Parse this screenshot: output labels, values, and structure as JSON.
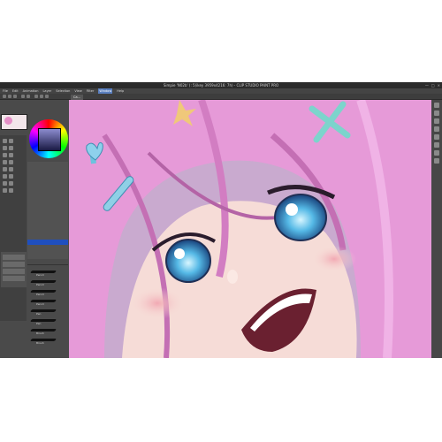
{
  "window": {
    "title": "Simpie 'N02b' (: 5(ikey 3959x4216: 7h) - CLIP STUDIO PAINT PRO",
    "controls": [
      "—",
      "□",
      "×"
    ]
  },
  "menubar": {
    "items": [
      "File",
      "Edit",
      "Animation",
      "Layer",
      "Selection",
      "View",
      "Filter",
      "Window",
      "Help"
    ],
    "active_index": 7
  },
  "canvas_tab": {
    "label": "Ca..."
  },
  "colors": {
    "accent": "#5a7fbf",
    "hair_pink": "#e69ad8",
    "eye_blue": "#4aa3d8",
    "skin": "#f6dcd7",
    "background_panel": "#4a4a4a"
  },
  "brush_labels": [
    "Pencil",
    "Pencil",
    "Pencil",
    "Pencil",
    "Pen",
    "Pen",
    "Brush",
    "Brush"
  ],
  "icons": [
    "search-icon",
    "hand-icon",
    "zoom-icon",
    "brush-icon",
    "eraser-icon",
    "select-icon",
    "fill-icon",
    "eyedropper-icon"
  ]
}
